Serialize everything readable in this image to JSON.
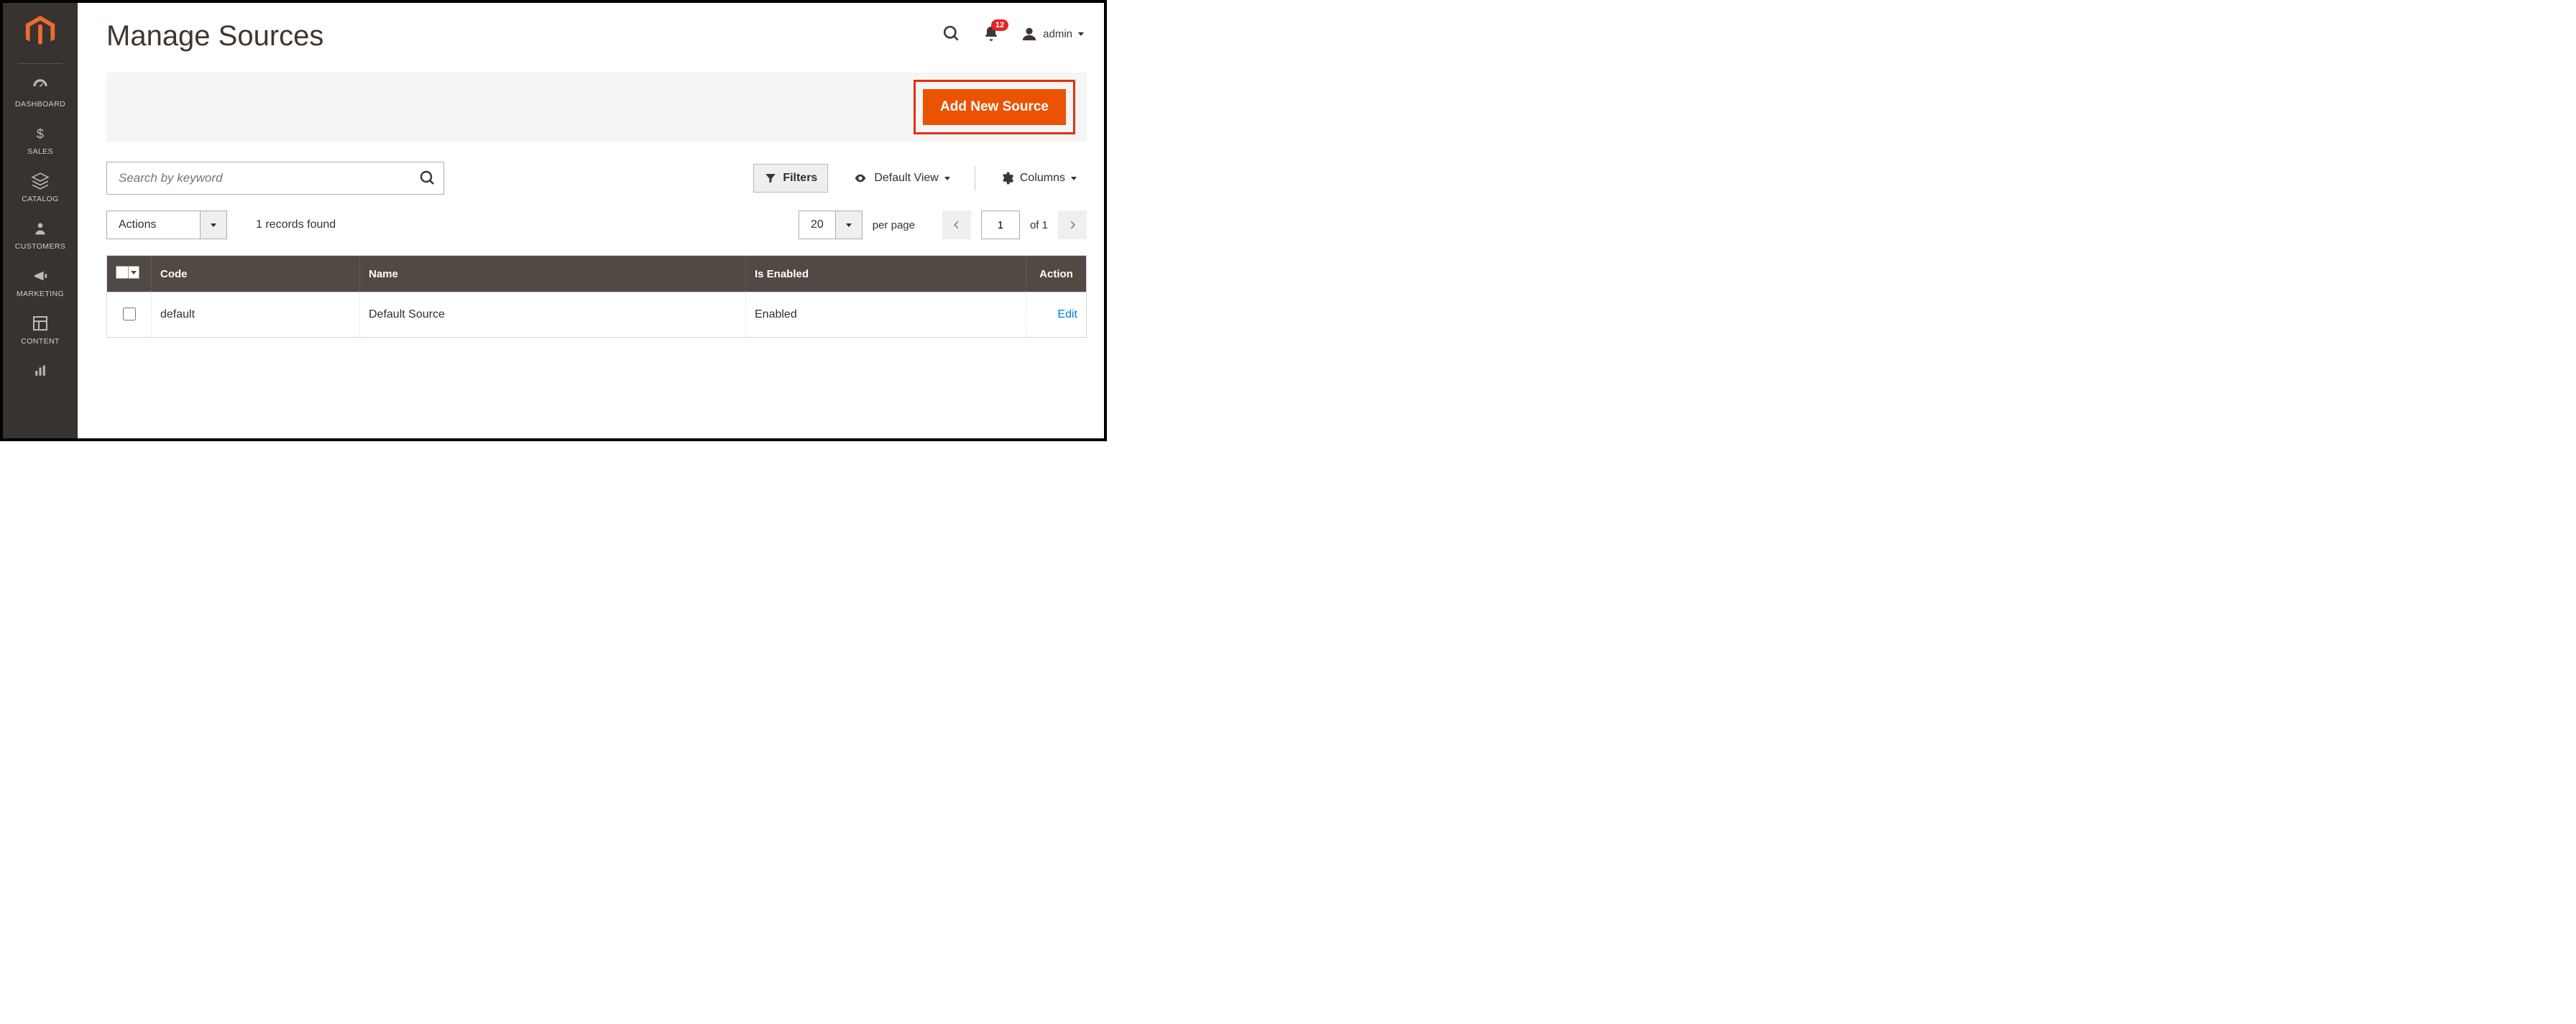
{
  "sidebar": {
    "items": [
      {
        "label": "DASHBOARD",
        "icon": "dashboard-icon"
      },
      {
        "label": "SALES",
        "icon": "dollar-icon"
      },
      {
        "label": "CATALOG",
        "icon": "catalog-icon"
      },
      {
        "label": "CUSTOMERS",
        "icon": "customers-icon"
      },
      {
        "label": "MARKETING",
        "icon": "marketing-icon"
      },
      {
        "label": "CONTENT",
        "icon": "content-icon"
      }
    ]
  },
  "header": {
    "title": "Manage Sources",
    "notification_count": "12",
    "user_label": "admin"
  },
  "actions": {
    "add_new_source_label": "Add New Source"
  },
  "toolbar": {
    "search_placeholder": "Search by keyword",
    "filters_label": "Filters",
    "default_view_label": "Default View",
    "columns_label": "Columns",
    "actions_label": "Actions",
    "records_found_label": "1 records found",
    "per_page_value": "20",
    "per_page_label": "per page",
    "page_value": "1",
    "of_label": "of 1"
  },
  "table": {
    "columns": {
      "code": "Code",
      "name": "Name",
      "is_enabled": "Is Enabled",
      "action": "Action"
    },
    "rows": [
      {
        "code": "default",
        "name": "Default Source",
        "is_enabled": "Enabled",
        "action": "Edit"
      }
    ]
  },
  "colors": {
    "accent": "#eb5202",
    "highlight": "#e4300a",
    "link": "#007bdb",
    "sidebar": "#373330",
    "table_header": "#514943",
    "badge": "#e22626"
  }
}
